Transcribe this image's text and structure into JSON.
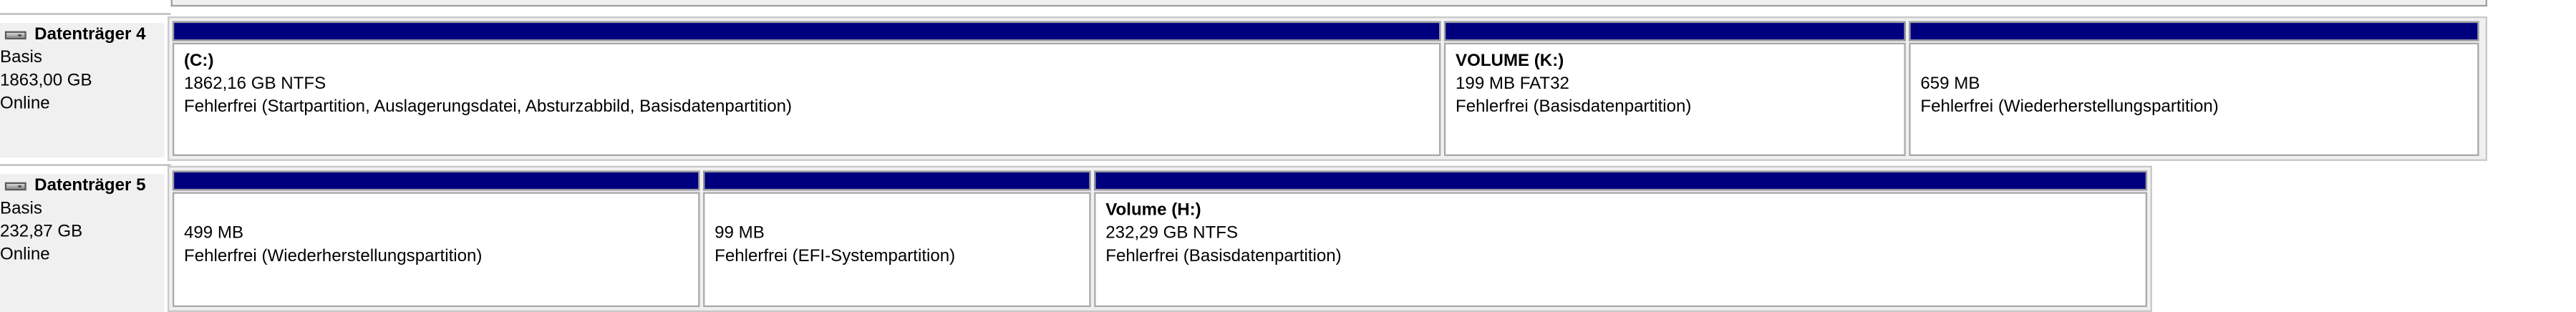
{
  "disks": [
    {
      "name": "Datenträger 4",
      "type": "Basis",
      "size": "1863,00 GB",
      "status": "Online",
      "partitions": [
        {
          "name": "(C:)",
          "info": "1862,16 GB NTFS",
          "status": "Fehlerfrei (Startpartition, Auslagerungsdatei, Absturzabbild, Basisdatenpartition)"
        },
        {
          "name": "VOLUME  (K:)",
          "info": "199 MB FAT32",
          "status": "Fehlerfrei (Basisdatenpartition)"
        },
        {
          "name": "",
          "info": "659 MB",
          "status": "Fehlerfrei (Wiederherstellungspartition)"
        }
      ]
    },
    {
      "name": "Datenträger 5",
      "type": "Basis",
      "size": "232,87 GB",
      "status": "Online",
      "partitions": [
        {
          "name": "",
          "info": "499 MB",
          "status": "Fehlerfrei (Wiederherstellungspartition)"
        },
        {
          "name": "",
          "info": "99 MB",
          "status": "Fehlerfrei (EFI-Systempartition)"
        },
        {
          "name": "Volume  (H:)",
          "info": "232,29 GB NTFS",
          "status": "Fehlerfrei (Basisdatenpartition)"
        }
      ]
    }
  ],
  "colors": {
    "partition_bar": "#00007f",
    "label_background": "#f0f0f0",
    "partition_background": "#ffffff"
  },
  "icons": {
    "disk": "hard-disk-icon"
  }
}
